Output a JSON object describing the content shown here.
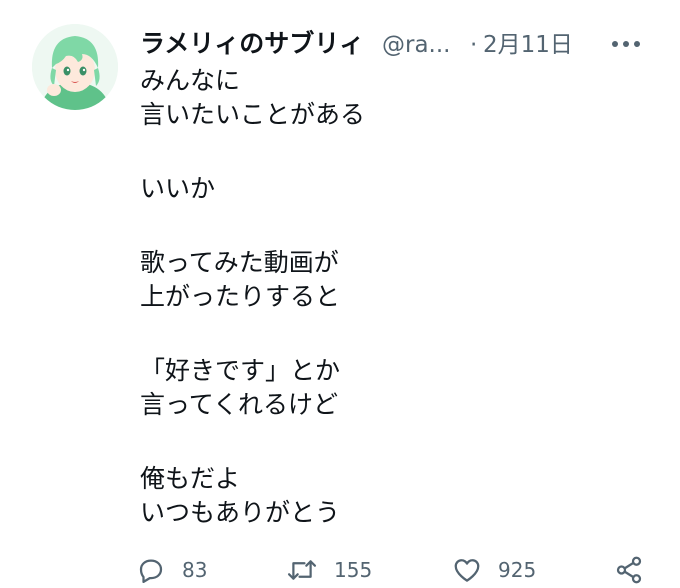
{
  "tweet": {
    "display_name": "ラメリィのサブリィ",
    "handle": "@ra...",
    "separator": "·",
    "date": "2月11日",
    "lines": [
      "みんなに",
      "言いたいことがある",
      "",
      "いいか",
      "",
      "歌ってみた動画が",
      "上がったりすると",
      "",
      "「好きです」とか",
      "言ってくれるけど",
      "",
      "俺もだよ",
      "いつもありがとう"
    ]
  },
  "actions": {
    "reply_count": "83",
    "retweet_count": "155",
    "like_count": "925"
  },
  "icons": {
    "more": "more-horizontal-icon",
    "reply": "reply-icon",
    "retweet": "retweet-icon",
    "like": "heart-icon",
    "share": "share-icon"
  },
  "colors": {
    "text_primary": "#0f1419",
    "text_secondary": "#536471",
    "avatar_hair": "#7fd8a6"
  }
}
